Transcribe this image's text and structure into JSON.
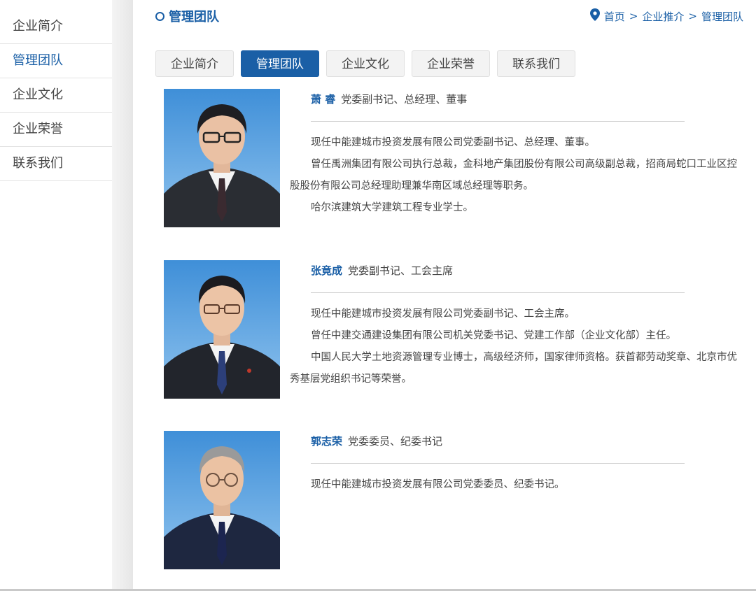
{
  "sidebar": {
    "items": [
      {
        "label": "企业简介",
        "active": false
      },
      {
        "label": "管理团队",
        "active": true
      },
      {
        "label": "企业文化",
        "active": false
      },
      {
        "label": "企业荣誉",
        "active": false
      },
      {
        "label": "联系我们",
        "active": false
      }
    ]
  },
  "header": {
    "title": "管理团队",
    "breadcrumb": [
      "首页",
      "企业推介",
      "管理团队"
    ],
    "breadcrumb_sep": ">"
  },
  "tabs": [
    {
      "label": "企业简介",
      "active": false
    },
    {
      "label": "管理团队",
      "active": true
    },
    {
      "label": "企业文化",
      "active": false
    },
    {
      "label": "企业荣誉",
      "active": false
    },
    {
      "label": "联系我们",
      "active": false
    }
  ],
  "members": [
    {
      "name": "萧 睿",
      "position": "党委副书记、总经理、董事",
      "bio": [
        "现任中能建城市投资发展有限公司党委副书记、总经理、董事。",
        "曾任禹洲集团有限公司执行总裁，金科地产集团股份有限公司高级副总裁，招商局蛇口工业区控股股份有限公司总经理助理兼华南区域总经理等职务。",
        "哈尔滨建筑大学建筑工程专业学士。"
      ]
    },
    {
      "name": "张竟成",
      "position": "党委副书记、工会主席",
      "bio": [
        "现任中能建城市投资发展有限公司党委副书记、工会主席。",
        "曾任中建交通建设集团有限公司机关党委书记、党建工作部（企业文化部）主任。",
        "中国人民大学土地资源管理专业博士，高级经济师，国家律师资格。获首都劳动奖章、北京市优秀基层党组织书记等荣誉。"
      ]
    },
    {
      "name": "郭志荣",
      "position": "党委委员、纪委书记",
      "bio": [
        "现任中能建城市投资发展有限公司党委委员、纪委书记。"
      ]
    }
  ],
  "colors": {
    "accent": "#1a5fa6",
    "photo_bg_top": "#3f8fd8",
    "photo_bg_bottom": "#8fc3ee"
  }
}
